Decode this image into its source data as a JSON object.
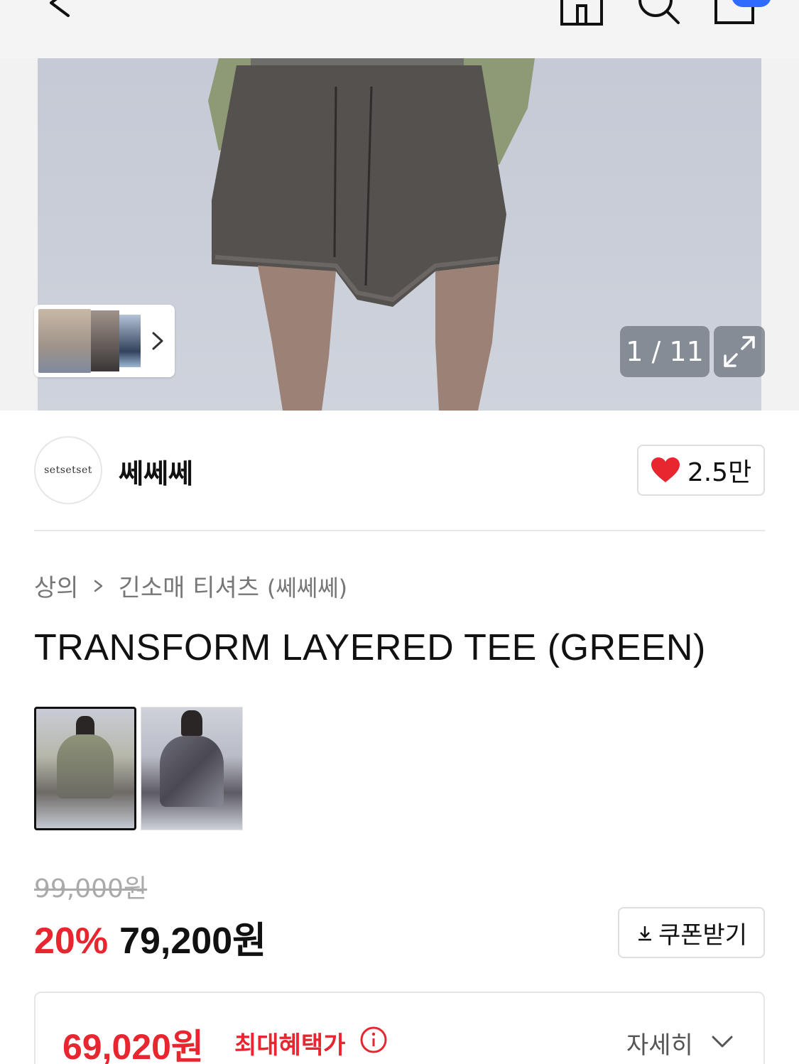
{
  "header": {
    "back_icon": "chevron-left-icon",
    "home_icon": "home-icon",
    "search_icon": "search-icon",
    "cart_icon": "cart-icon",
    "cart_badge_color": "#2f6bff"
  },
  "gallery": {
    "counter": "1 / 11",
    "expand_icon": "expand-icon"
  },
  "brand": {
    "logo_text": "setsetset",
    "name": "쎄쎄쎄",
    "likes": "2.5만",
    "heart_color": "#e8262f"
  },
  "breadcrumb": {
    "category": "상의",
    "subcategory": "긴소매 티셔츠",
    "brand": "(쎄쎄쎄)"
  },
  "product": {
    "title": "TRANSFORM LAYERED TEE (GREEN)"
  },
  "price": {
    "original": "99,000원",
    "discount": "20%",
    "sale": "79,200원",
    "coupon_label": "쿠폰받기",
    "accent_color": "#e8262f"
  },
  "benefit": {
    "price": "69,020원",
    "label": "최대혜택가",
    "more_label": "자세히"
  }
}
